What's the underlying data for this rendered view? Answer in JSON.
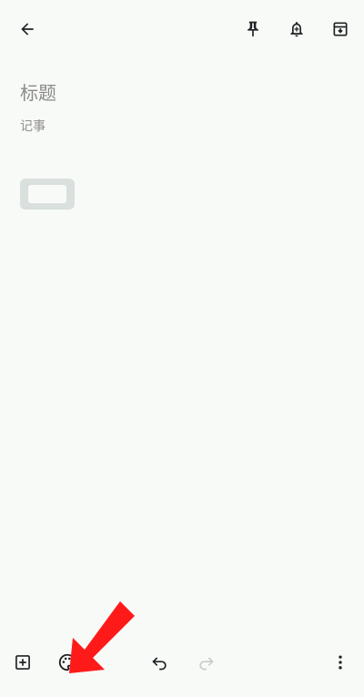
{
  "topbar": {
    "back_icon": "arrow-left-icon",
    "pin_icon": "pin-icon",
    "reminder_icon": "bell-plus-icon",
    "archive_icon": "archive-icon"
  },
  "content": {
    "title_placeholder": "标题",
    "note_placeholder": "记事"
  },
  "bottombar": {
    "add_icon": "plus-box-icon",
    "palette_icon": "palette-icon",
    "undo_icon": "undo-icon",
    "redo_icon": "redo-icon",
    "more_icon": "more-vert-icon"
  },
  "colors": {
    "background": "#f8faf7",
    "icon": "#202124",
    "disabled_icon": "#c8ccca",
    "annotation_arrow": "#ff1a1a"
  }
}
